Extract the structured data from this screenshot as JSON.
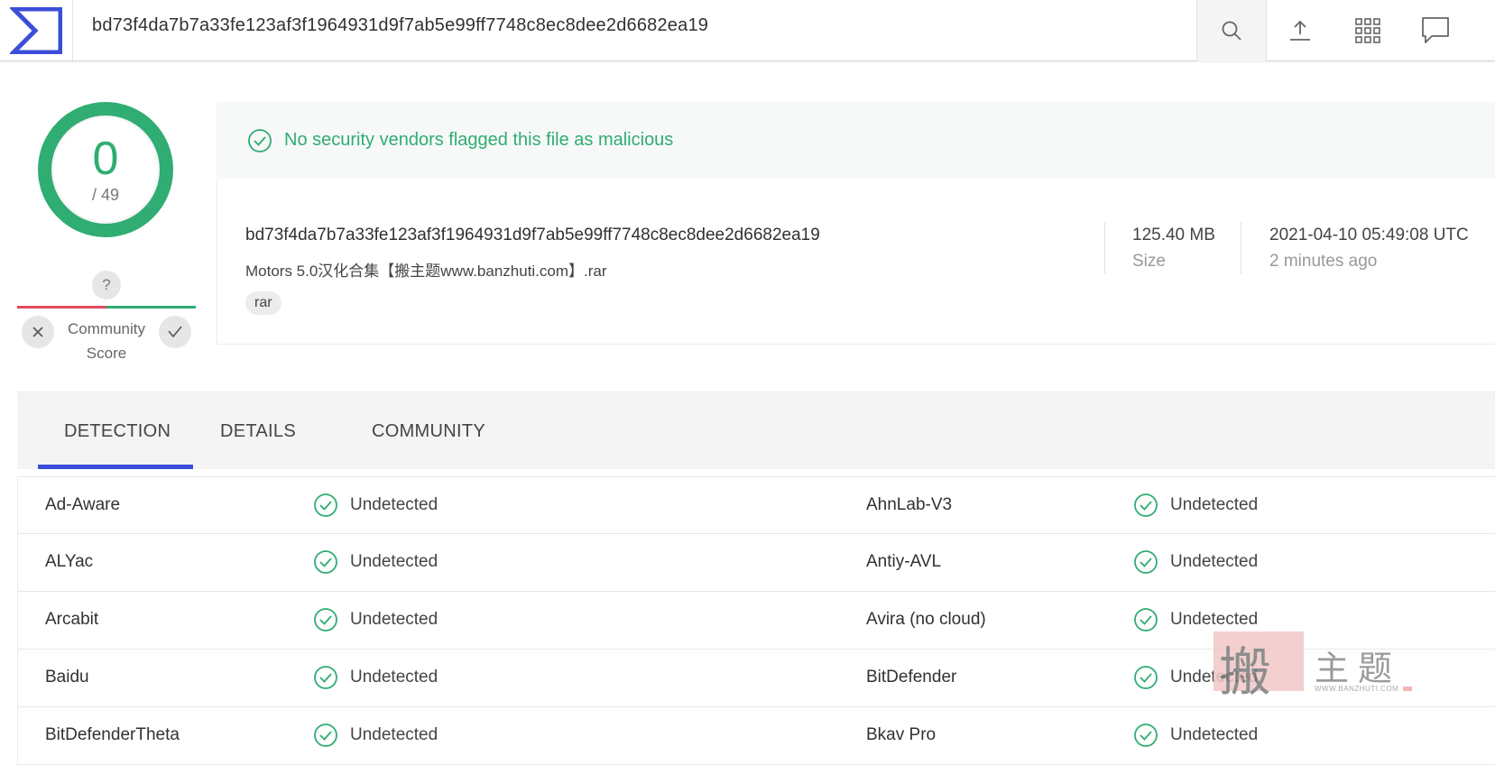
{
  "header": {
    "search_value": "bd73f4da7b7a33fe123af3f1964931d9f7ab5e99ff7748c8ec8dee2d6682ea19",
    "icons": [
      "search-icon",
      "upload-icon",
      "grid-icon",
      "chat-icon"
    ]
  },
  "score": {
    "detections": "0",
    "total": "/ 49",
    "community_question": "?",
    "community_label_1": "Community",
    "community_label_2": "Score",
    "ratio_malicious": 0.5
  },
  "banner": {
    "message": "No security vendors flagged this file as malicious"
  },
  "file": {
    "hash": "bd73f4da7b7a33fe123af3f1964931d9f7ab5e99ff7748c8ec8dee2d6682ea19",
    "name": "Motors 5.0汉化合集【搬主题www.banzhuti.com】.rar",
    "tag": "rar",
    "size_value": "125.40 MB",
    "size_label": "Size",
    "date_value": "2021-04-10 05:49:08 UTC",
    "date_label": "2 minutes ago"
  },
  "tabs": [
    {
      "label": "DETECTION",
      "active": true
    },
    {
      "label": "DETAILS",
      "active": false
    },
    {
      "label": "COMMUNITY",
      "active": false
    }
  ],
  "detections": [
    {
      "left_name": "Ad-Aware",
      "left_result": "Undetected",
      "right_name": "AhnLab-V3",
      "right_result": "Undetected"
    },
    {
      "left_name": "ALYac",
      "left_result": "Undetected",
      "right_name": "Antiy-AVL",
      "right_result": "Undetected"
    },
    {
      "left_name": "Arcabit",
      "left_result": "Undetected",
      "right_name": "Avira (no cloud)",
      "right_result": "Undetected"
    },
    {
      "left_name": "Baidu",
      "left_result": "Undetected",
      "right_name": "BitDefender",
      "right_result": "Undetected"
    },
    {
      "left_name": "BitDefenderTheta",
      "left_result": "Undetected",
      "right_name": "Bkav Pro",
      "right_result": "Undetected"
    }
  ],
  "watermark": {
    "chars": "搬主题",
    "url": "WWW.BANZHUTI.COM"
  },
  "colors": {
    "accent_green": "#2fad72",
    "accent_blue": "#3a4ed8",
    "accent_red": "#e24a5e"
  }
}
